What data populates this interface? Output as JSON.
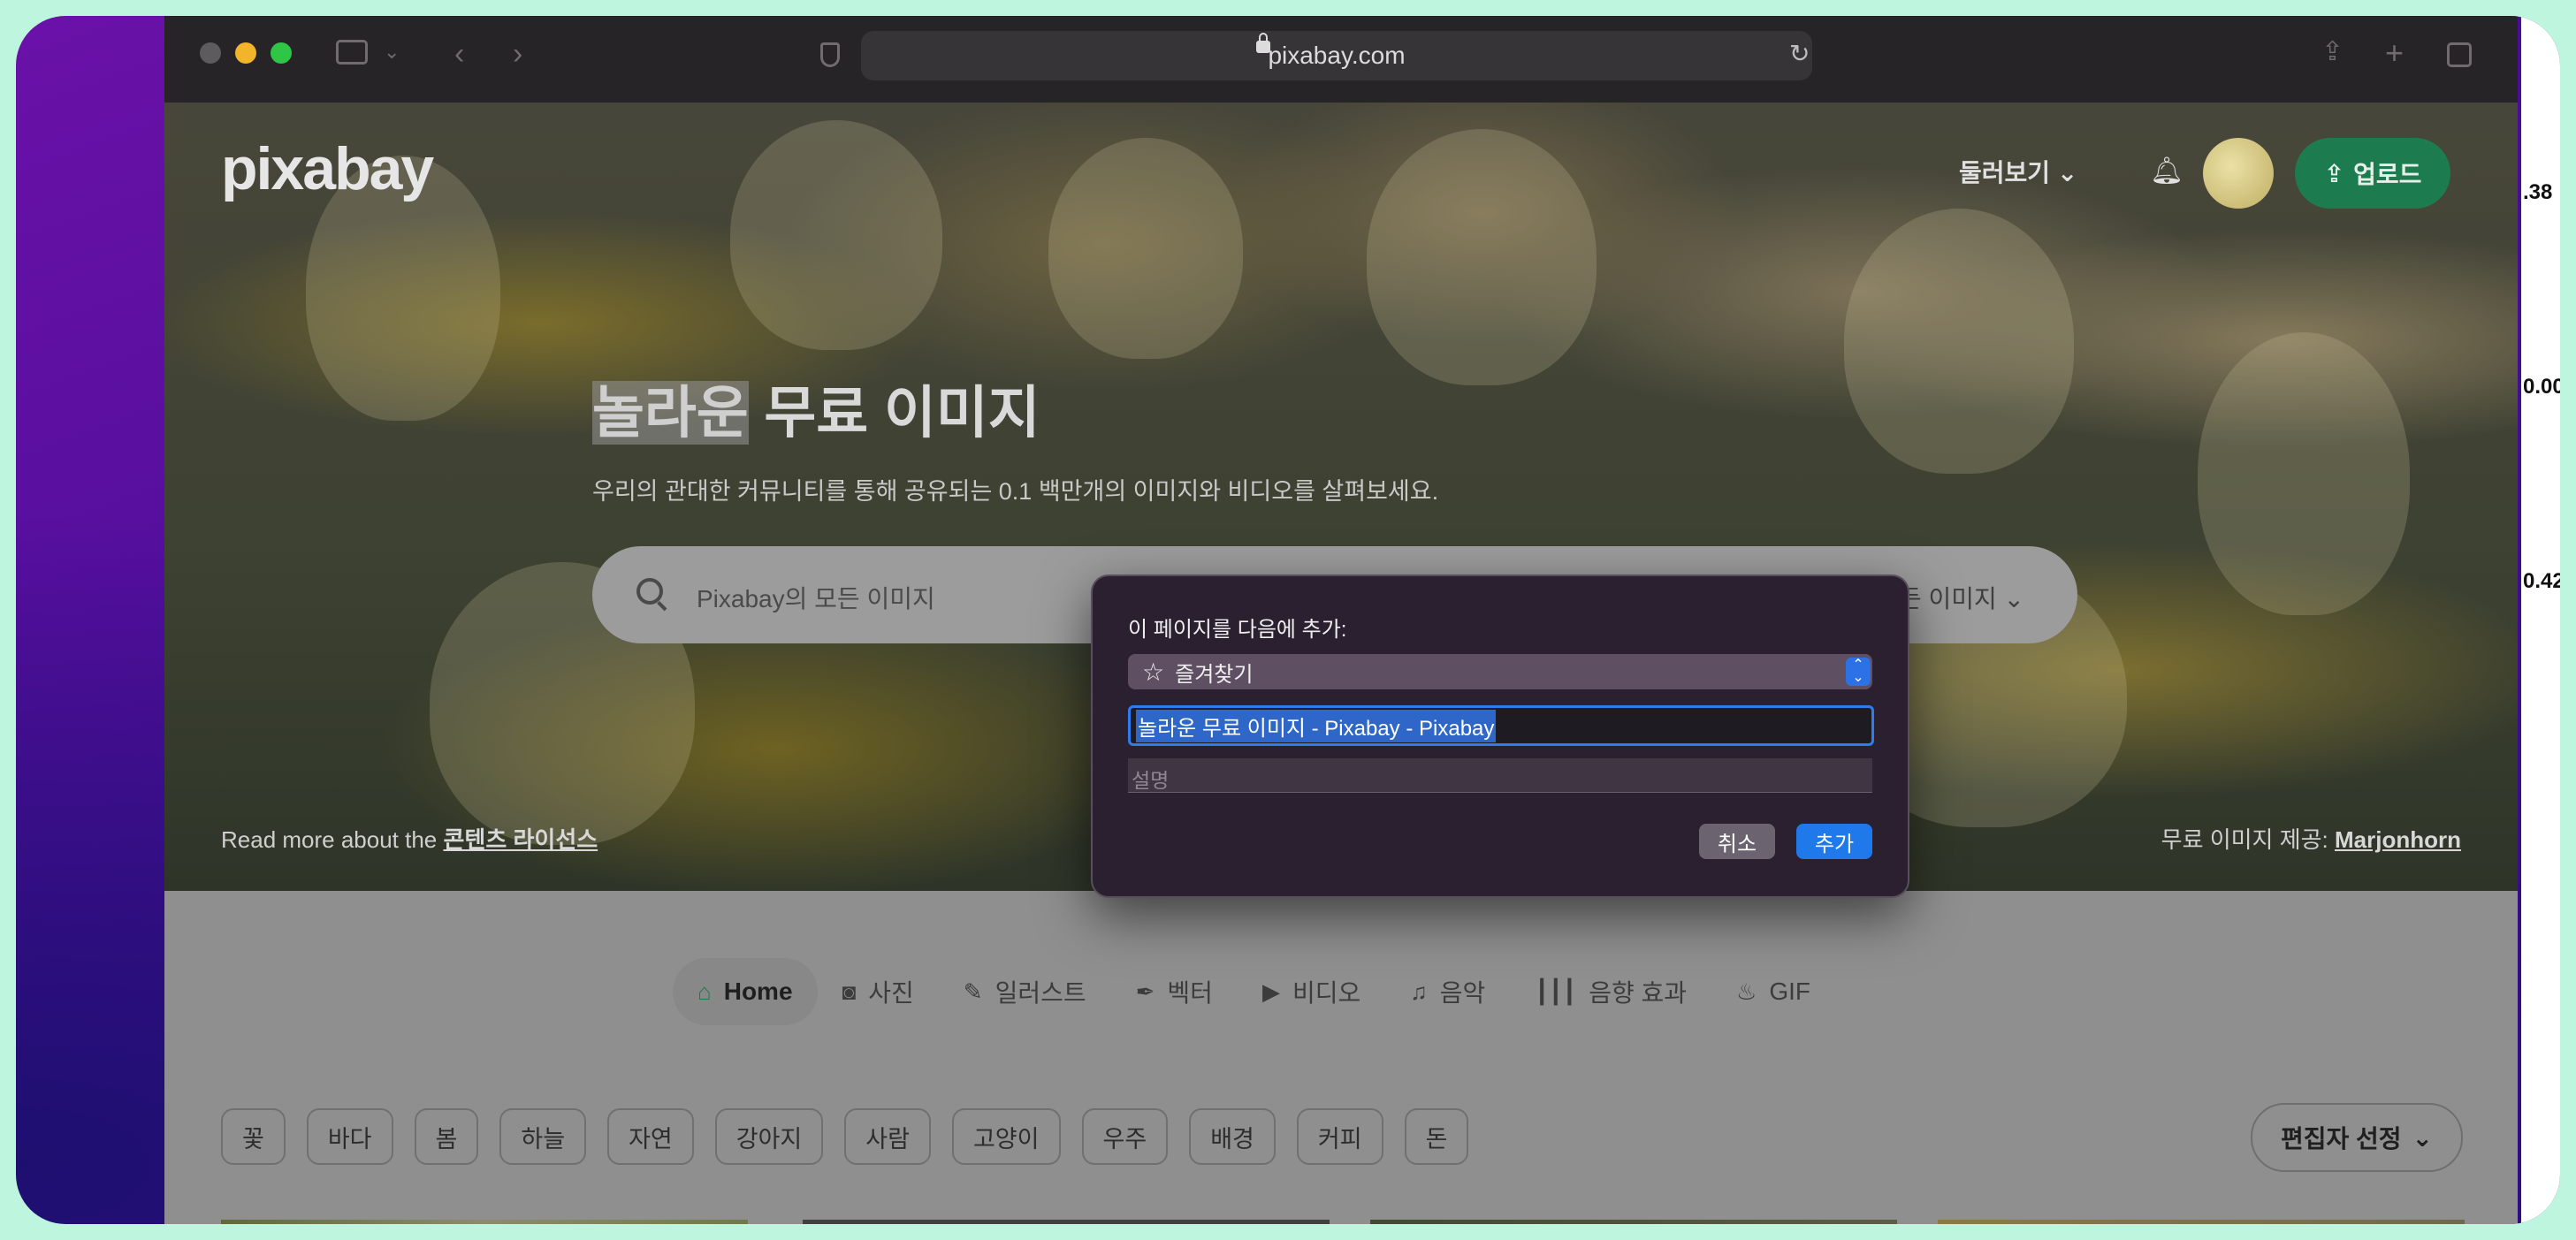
{
  "browser": {
    "url": "pixabay.com"
  },
  "desktop": {
    "right_values": [
      ".38",
      "0.00",
      "0.42"
    ]
  },
  "site": {
    "logo": "pixabay",
    "explore_label": "둘러보기",
    "upload_label": "업로드",
    "hero_title_highlight": "놀라운",
    "hero_title_rest": " 무료 이미지",
    "hero_subtitle": "우리의 관대한 커뮤니티를 통해 공유되는 0.1 백만개의 이미지와 비디오를 살펴보세요.",
    "search_placeholder": "Pixabay의 모든 이미지",
    "search_type": "모든 이미지",
    "license_prefix": "Read more about the ",
    "license_link": "콘텐츠 라이선스",
    "credit_prefix": "무료 이미지 제공: ",
    "credit_link": "Marjonhorn"
  },
  "tabs": [
    {
      "label": "Home",
      "icon": "home-icon"
    },
    {
      "label": "사진",
      "icon": "camera-icon"
    },
    {
      "label": "일러스트",
      "icon": "brush-icon"
    },
    {
      "label": "벡터",
      "icon": "pen-nib-icon"
    },
    {
      "label": "비디오",
      "icon": "video-icon"
    },
    {
      "label": "음악",
      "icon": "music-icon"
    },
    {
      "label": "음향 효과",
      "icon": "waveform-icon"
    },
    {
      "label": "GIF",
      "icon": "flame-icon"
    }
  ],
  "chips": [
    "꽃",
    "바다",
    "봄",
    "하늘",
    "자연",
    "강아지",
    "사람",
    "고양이",
    "우주",
    "배경",
    "커피",
    "돈"
  ],
  "editors_label": "편집자 선정",
  "dialog": {
    "title": "이 페이지를 다음에 추가:",
    "folder": "즐겨찾기",
    "name_value": "놀라운 무료 이미지 - Pixabay - Pixabay",
    "description_placeholder": "설명",
    "cancel_label": "취소",
    "add_label": "추가"
  },
  "colors": {
    "accent_blue": "#1f79ea",
    "upload_green": "#1d7c4f",
    "desktop_purple": "#4a0d98"
  }
}
